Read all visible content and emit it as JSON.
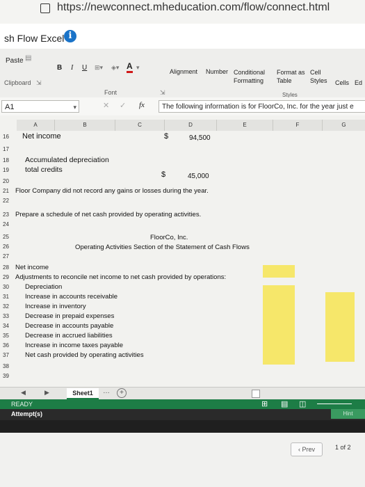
{
  "browser": {
    "url": "https://newconnect.mheducation.com/flow/connect.html"
  },
  "app": {
    "title": "sh Flow Excel"
  },
  "ribbon": {
    "paste": "Paste",
    "clipboard": "Clipboard",
    "bold": "B",
    "italic": "I",
    "underline": "U",
    "font_color": "A",
    "font_group": "Font",
    "alignment": "Alignment",
    "number": "Number",
    "conditional_formatting": "Conditional Formatting",
    "format_as_table": "Format as Table",
    "cell_styles": "Cell Styles",
    "styles_group": "Styles",
    "cells": "Cells",
    "editing_partial": "Ed"
  },
  "formula_bar": {
    "cell_ref": "A1",
    "fx": "fx",
    "content": "The following information is for FloorCo, Inc. for the year just e"
  },
  "columns": [
    "A",
    "B",
    "C",
    "D",
    "E",
    "F",
    "G"
  ],
  "rows": [
    {
      "num": "16",
      "text": "Net income",
      "dollar": "$",
      "amount": "94,500"
    },
    {
      "num": "17",
      "text": ""
    },
    {
      "num": "18",
      "text": "Accumulated depreciation"
    },
    {
      "num": "19",
      "text": "total credits",
      "dollar": "$",
      "amount": "45,000"
    },
    {
      "num": "20",
      "text": ""
    },
    {
      "num": "21",
      "text": "Floor Company did not record any gains or losses during the year."
    },
    {
      "num": "22",
      "text": ""
    },
    {
      "num": "23",
      "text": "Prepare a schedule of net cash provided by operating activities."
    },
    {
      "num": "24",
      "text": ""
    },
    {
      "num": "25",
      "text": "FloorCo, Inc."
    },
    {
      "num": "26",
      "text": "Operating Activities Section of the Statement of Cash Flows"
    },
    {
      "num": "27",
      "text": ""
    },
    {
      "num": "28",
      "text": "Net income"
    },
    {
      "num": "29",
      "text": "Adjustments to reconcile net income to net cash provided by operations:"
    },
    {
      "num": "30",
      "text": "Depreciation"
    },
    {
      "num": "31",
      "text": "Increase in accounts receivable"
    },
    {
      "num": "32",
      "text": "Increase in inventory"
    },
    {
      "num": "33",
      "text": "Decrease in prepaid expenses"
    },
    {
      "num": "34",
      "text": "Decrease in accounts payable"
    },
    {
      "num": "35",
      "text": "Decrease in accrued liabilities"
    },
    {
      "num": "36",
      "text": "Increase in income taxes payable"
    },
    {
      "num": "37",
      "text": "Net cash provided by operating activities"
    },
    {
      "num": "38",
      "text": ""
    },
    {
      "num": "39",
      "text": ""
    }
  ],
  "sheet_tab": "Sheet1",
  "status": {
    "ready": "READY",
    "attempt": "Attempt(s)",
    "hint": "Hint"
  },
  "nav": {
    "prev": "Prev",
    "page": "1",
    "of": "of 2"
  },
  "colors": {
    "highlight": "#f6e76a",
    "status_green": "#1d7d46",
    "accent_blue": "#1a73c8"
  }
}
